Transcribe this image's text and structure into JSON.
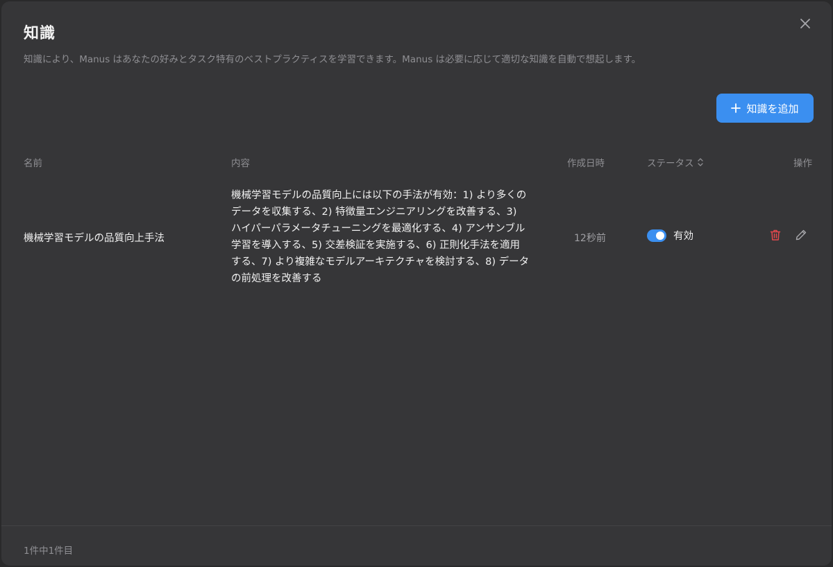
{
  "dialog": {
    "title": "知識",
    "description": "知識により、Manus はあなたの好みとタスク特有のベストプラクティスを学習できます。Manus は必要に応じて適切な知識を自動で想起します。",
    "add_button_label": "知識を追加"
  },
  "table": {
    "headers": {
      "name": "名前",
      "content": "内容",
      "created": "作成日時",
      "status": "ステータス",
      "actions": "操作"
    },
    "rows": [
      {
        "name": "機械学習モデルの品質向上手法",
        "content": "機械学習モデルの品質向上には以下の手法が有効：1) より多くのデータを収集する、2) 特徴量エンジニアリングを改善する、3) ハイパーパラメータチューニングを最適化する、4) アンサンブル学習を導入する、5) 交差検証を実施する、6) 正則化手法を適用する、7) より複雑なモデルアーキテクチャを検討する、8) データの前処理を改善する",
        "created": "12秒前",
        "status_enabled": true,
        "status_label": "有効"
      }
    ]
  },
  "footer": {
    "pagination": "1件中1件目"
  },
  "colors": {
    "accent": "#3b8ff0",
    "danger": "#e5484d",
    "background": "#363638"
  },
  "icons": {
    "close": "close-icon",
    "plus": "plus-icon",
    "sort": "sort-icon",
    "delete": "trash-icon",
    "edit": "pencil-icon"
  }
}
